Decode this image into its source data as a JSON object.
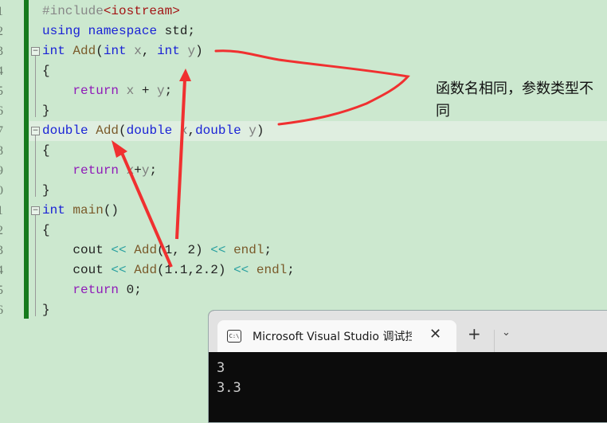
{
  "editor": {
    "line_numbers": [
      "1",
      "2",
      "3",
      "4",
      "5",
      "6",
      "7",
      "8",
      "9",
      "0",
      "1",
      "2",
      "3",
      "4",
      "5",
      "6"
    ],
    "lines": [
      [
        {
          "t": "#include",
          "c": "pp"
        },
        {
          "t": "<iostream>",
          "c": "str"
        }
      ],
      [
        {
          "t": "using",
          "c": "kw"
        },
        {
          "t": " "
        },
        {
          "t": "namespace",
          "c": "kw"
        },
        {
          "t": " std;"
        }
      ],
      [
        {
          "t": "int",
          "c": "kw"
        },
        {
          "t": " "
        },
        {
          "t": "Add",
          "c": "fn"
        },
        {
          "t": "("
        },
        {
          "t": "int",
          "c": "kw"
        },
        {
          "t": " "
        },
        {
          "t": "x",
          "c": "var"
        },
        {
          "t": ", "
        },
        {
          "t": "int",
          "c": "kw"
        },
        {
          "t": " "
        },
        {
          "t": "y",
          "c": "var"
        },
        {
          "t": ")"
        }
      ],
      [
        {
          "t": "{"
        }
      ],
      [
        {
          "t": "    "
        },
        {
          "t": "return",
          "c": "ret"
        },
        {
          "t": " "
        },
        {
          "t": "x",
          "c": "var"
        },
        {
          "t": " + "
        },
        {
          "t": "y",
          "c": "var"
        },
        {
          "t": ";"
        }
      ],
      [
        {
          "t": "}"
        }
      ],
      [
        {
          "t": "double",
          "c": "kw"
        },
        {
          "t": " "
        },
        {
          "t": "Add",
          "c": "fn"
        },
        {
          "t": "("
        },
        {
          "t": "double",
          "c": "kw"
        },
        {
          "t": " "
        },
        {
          "t": "x",
          "c": "var"
        },
        {
          "t": ","
        },
        {
          "t": "double",
          "c": "kw"
        },
        {
          "t": " "
        },
        {
          "t": "y",
          "c": "var"
        },
        {
          "t": ")"
        }
      ],
      [
        {
          "t": "{"
        }
      ],
      [
        {
          "t": "    "
        },
        {
          "t": "return",
          "c": "ret"
        },
        {
          "t": " "
        },
        {
          "t": "x",
          "c": "var"
        },
        {
          "t": "+"
        },
        {
          "t": "y",
          "c": "var"
        },
        {
          "t": ";"
        }
      ],
      [
        {
          "t": "}"
        }
      ],
      [
        {
          "t": "int",
          "c": "kw"
        },
        {
          "t": " "
        },
        {
          "t": "main",
          "c": "fn"
        },
        {
          "t": "()"
        }
      ],
      [
        {
          "t": "{"
        }
      ],
      [
        {
          "t": "    cout "
        },
        {
          "t": "<<",
          "c": "op"
        },
        {
          "t": " "
        },
        {
          "t": "Add",
          "c": "fn"
        },
        {
          "t": "(1, 2) "
        },
        {
          "t": "<<",
          "c": "op"
        },
        {
          "t": " "
        },
        {
          "t": "endl",
          "c": "fn"
        },
        {
          "t": ";"
        }
      ],
      [
        {
          "t": "    cout "
        },
        {
          "t": "<<",
          "c": "op"
        },
        {
          "t": " "
        },
        {
          "t": "Add",
          "c": "fn"
        },
        {
          "t": "(1.1,2.2) "
        },
        {
          "t": "<<",
          "c": "op"
        },
        {
          "t": " "
        },
        {
          "t": "endl",
          "c": "fn"
        },
        {
          "t": ";"
        }
      ],
      [
        {
          "t": "    "
        },
        {
          "t": "return",
          "c": "ret"
        },
        {
          "t": " 0;"
        }
      ],
      [
        {
          "t": "}"
        }
      ]
    ],
    "highlighted_line": 7
  },
  "annotation": {
    "text": "函数名相同，参数类型不同",
    "color": "#f03030"
  },
  "terminal": {
    "tab_title": "Microsoft Visual Studio 调试控制台",
    "tab_icon": "console-icon",
    "icon_text": "C:\\",
    "close_glyph": "✕",
    "new_tab_glyph": "+",
    "dropdown_glyph": "⌄",
    "output": [
      "3",
      "3.3"
    ]
  }
}
